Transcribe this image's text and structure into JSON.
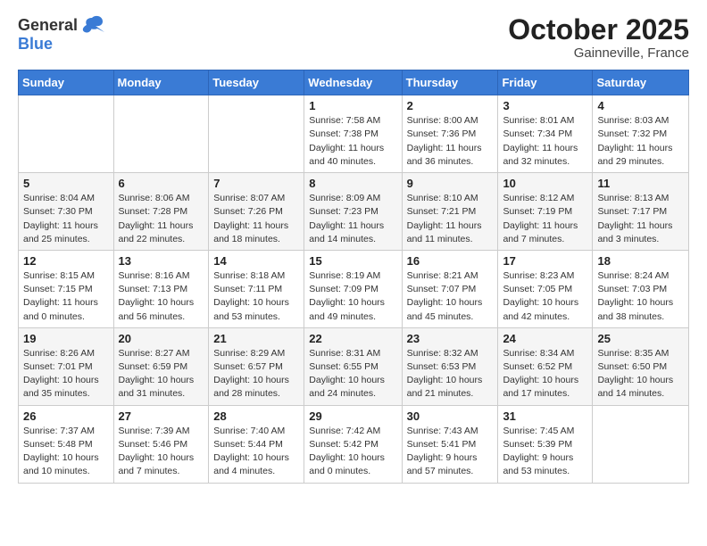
{
  "header": {
    "logo_general": "General",
    "logo_blue": "Blue",
    "month_title": "October 2025",
    "location": "Gainneville, France"
  },
  "weekdays": [
    "Sunday",
    "Monday",
    "Tuesday",
    "Wednesday",
    "Thursday",
    "Friday",
    "Saturday"
  ],
  "weeks": [
    [
      {
        "day": "",
        "info": ""
      },
      {
        "day": "",
        "info": ""
      },
      {
        "day": "",
        "info": ""
      },
      {
        "day": "1",
        "info": "Sunrise: 7:58 AM\nSunset: 7:38 PM\nDaylight: 11 hours and 40 minutes."
      },
      {
        "day": "2",
        "info": "Sunrise: 8:00 AM\nSunset: 7:36 PM\nDaylight: 11 hours and 36 minutes."
      },
      {
        "day": "3",
        "info": "Sunrise: 8:01 AM\nSunset: 7:34 PM\nDaylight: 11 hours and 32 minutes."
      },
      {
        "day": "4",
        "info": "Sunrise: 8:03 AM\nSunset: 7:32 PM\nDaylight: 11 hours and 29 minutes."
      }
    ],
    [
      {
        "day": "5",
        "info": "Sunrise: 8:04 AM\nSunset: 7:30 PM\nDaylight: 11 hours and 25 minutes."
      },
      {
        "day": "6",
        "info": "Sunrise: 8:06 AM\nSunset: 7:28 PM\nDaylight: 11 hours and 22 minutes."
      },
      {
        "day": "7",
        "info": "Sunrise: 8:07 AM\nSunset: 7:26 PM\nDaylight: 11 hours and 18 minutes."
      },
      {
        "day": "8",
        "info": "Sunrise: 8:09 AM\nSunset: 7:23 PM\nDaylight: 11 hours and 14 minutes."
      },
      {
        "day": "9",
        "info": "Sunrise: 8:10 AM\nSunset: 7:21 PM\nDaylight: 11 hours and 11 minutes."
      },
      {
        "day": "10",
        "info": "Sunrise: 8:12 AM\nSunset: 7:19 PM\nDaylight: 11 hours and 7 minutes."
      },
      {
        "day": "11",
        "info": "Sunrise: 8:13 AM\nSunset: 7:17 PM\nDaylight: 11 hours and 3 minutes."
      }
    ],
    [
      {
        "day": "12",
        "info": "Sunrise: 8:15 AM\nSunset: 7:15 PM\nDaylight: 11 hours and 0 minutes."
      },
      {
        "day": "13",
        "info": "Sunrise: 8:16 AM\nSunset: 7:13 PM\nDaylight: 10 hours and 56 minutes."
      },
      {
        "day": "14",
        "info": "Sunrise: 8:18 AM\nSunset: 7:11 PM\nDaylight: 10 hours and 53 minutes."
      },
      {
        "day": "15",
        "info": "Sunrise: 8:19 AM\nSunset: 7:09 PM\nDaylight: 10 hours and 49 minutes."
      },
      {
        "day": "16",
        "info": "Sunrise: 8:21 AM\nSunset: 7:07 PM\nDaylight: 10 hours and 45 minutes."
      },
      {
        "day": "17",
        "info": "Sunrise: 8:23 AM\nSunset: 7:05 PM\nDaylight: 10 hours and 42 minutes."
      },
      {
        "day": "18",
        "info": "Sunrise: 8:24 AM\nSunset: 7:03 PM\nDaylight: 10 hours and 38 minutes."
      }
    ],
    [
      {
        "day": "19",
        "info": "Sunrise: 8:26 AM\nSunset: 7:01 PM\nDaylight: 10 hours and 35 minutes."
      },
      {
        "day": "20",
        "info": "Sunrise: 8:27 AM\nSunset: 6:59 PM\nDaylight: 10 hours and 31 minutes."
      },
      {
        "day": "21",
        "info": "Sunrise: 8:29 AM\nSunset: 6:57 PM\nDaylight: 10 hours and 28 minutes."
      },
      {
        "day": "22",
        "info": "Sunrise: 8:31 AM\nSunset: 6:55 PM\nDaylight: 10 hours and 24 minutes."
      },
      {
        "day": "23",
        "info": "Sunrise: 8:32 AM\nSunset: 6:53 PM\nDaylight: 10 hours and 21 minutes."
      },
      {
        "day": "24",
        "info": "Sunrise: 8:34 AM\nSunset: 6:52 PM\nDaylight: 10 hours and 17 minutes."
      },
      {
        "day": "25",
        "info": "Sunrise: 8:35 AM\nSunset: 6:50 PM\nDaylight: 10 hours and 14 minutes."
      }
    ],
    [
      {
        "day": "26",
        "info": "Sunrise: 7:37 AM\nSunset: 5:48 PM\nDaylight: 10 hours and 10 minutes."
      },
      {
        "day": "27",
        "info": "Sunrise: 7:39 AM\nSunset: 5:46 PM\nDaylight: 10 hours and 7 minutes."
      },
      {
        "day": "28",
        "info": "Sunrise: 7:40 AM\nSunset: 5:44 PM\nDaylight: 10 hours and 4 minutes."
      },
      {
        "day": "29",
        "info": "Sunrise: 7:42 AM\nSunset: 5:42 PM\nDaylight: 10 hours and 0 minutes."
      },
      {
        "day": "30",
        "info": "Sunrise: 7:43 AM\nSunset: 5:41 PM\nDaylight: 9 hours and 57 minutes."
      },
      {
        "day": "31",
        "info": "Sunrise: 7:45 AM\nSunset: 5:39 PM\nDaylight: 9 hours and 53 minutes."
      },
      {
        "day": "",
        "info": ""
      }
    ]
  ]
}
